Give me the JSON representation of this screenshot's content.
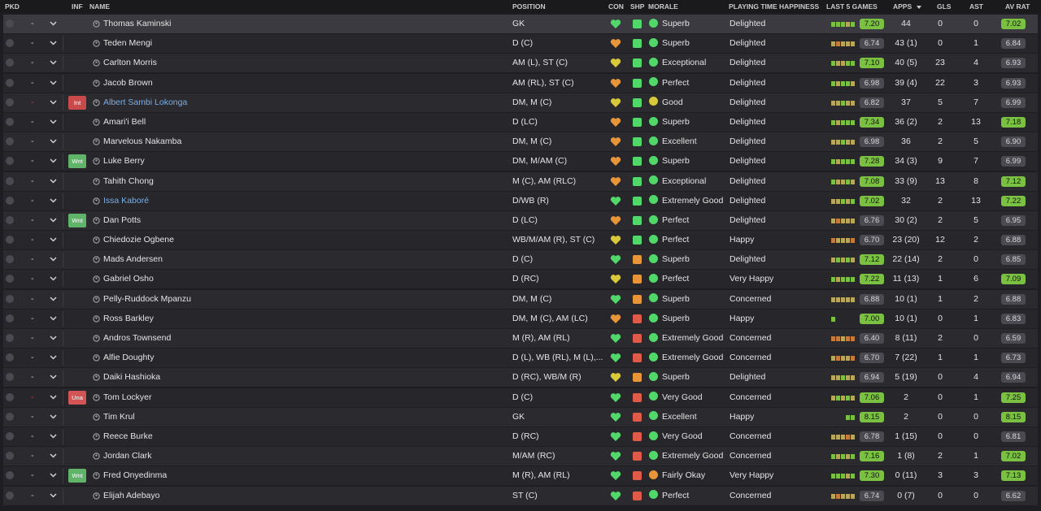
{
  "headers": {
    "pkd": "PKD",
    "inf": "INF",
    "name": "NAME",
    "position": "POSITION",
    "con": "CON",
    "shp": "SHP",
    "morale": "MORALE",
    "pth": "PLAYING TIME HAPPINESS",
    "l5": "LAST 5 GAMES",
    "apps": "APPS",
    "gls": "GLS",
    "ast": "AST",
    "avr": "AV RAT"
  },
  "colors": {
    "rating_high": "#7ac142",
    "rating_mid": "#4a4a50",
    "inf_red": "#c84a4a",
    "inf_green": "#5fb46a",
    "name_link": "#7aaee6"
  },
  "players": [
    {
      "name": "Thomas Kaminski",
      "position": "GK",
      "con": "green",
      "shp": "green",
      "morale_icon": "green",
      "morale": "Superb",
      "pth": "Delighted",
      "l5_rating": "7.20",
      "l5_hi": true,
      "l5_bars": [
        "hi",
        "hi",
        "hi",
        "mid",
        "hi"
      ],
      "apps": "44",
      "gls": "0",
      "ast": "0",
      "avr": "7.02",
      "avr_hi": true,
      "inf": "",
      "dash_red": false,
      "name_link": false,
      "selected": true
    },
    {
      "name": "Teden Mengi",
      "position": "D (C)",
      "con": "orange",
      "shp": "green",
      "morale_icon": "green",
      "morale": "Superb",
      "pth": "Delighted",
      "l5_rating": "6.74",
      "l5_hi": false,
      "l5_bars": [
        "mid",
        "lo",
        "mid",
        "mid",
        "mid"
      ],
      "apps": "43 (1)",
      "gls": "0",
      "ast": "1",
      "avr": "6.84",
      "avr_hi": false,
      "inf": "",
      "dash_red": false,
      "name_link": false
    },
    {
      "name": "Carlton Morris",
      "position": "AM (L), ST (C)",
      "con": "yellow",
      "shp": "green",
      "morale_icon": "green",
      "morale": "Exceptional",
      "pth": "Delighted",
      "l5_rating": "7.10",
      "l5_hi": true,
      "l5_bars": [
        "hi",
        "mid",
        "mid",
        "hi",
        "hi"
      ],
      "apps": "40 (5)",
      "gls": "23",
      "ast": "4",
      "avr": "6.93",
      "avr_hi": false,
      "inf": "",
      "dash_red": false,
      "name_link": false
    },
    {
      "name": "Jacob Brown",
      "position": "AM (RL), ST (C)",
      "con": "orange",
      "shp": "green",
      "morale_icon": "green",
      "morale": "Perfect",
      "pth": "Delighted",
      "l5_rating": "6.98",
      "l5_hi": false,
      "l5_bars": [
        "hi",
        "mid",
        "hi",
        "hi",
        "mid"
      ],
      "apps": "39 (4)",
      "gls": "22",
      "ast": "3",
      "avr": "6.93",
      "avr_hi": false,
      "inf": "",
      "dash_red": false,
      "name_link": false
    },
    {
      "name": "Albert Sambi Lokonga",
      "position": "DM, M (C)",
      "con": "yellow",
      "shp": "green",
      "morale_icon": "yellow",
      "morale": "Good",
      "pth": "Delighted",
      "l5_rating": "6.82",
      "l5_hi": false,
      "l5_bars": [
        "mid",
        "mid",
        "hi",
        "mid",
        "mid"
      ],
      "apps": "37",
      "gls": "5",
      "ast": "7",
      "avr": "6.99",
      "avr_hi": false,
      "inf": "Int",
      "dash_red": true,
      "name_link": true
    },
    {
      "name": "Amari'i Bell",
      "position": "D (LC)",
      "con": "orange",
      "shp": "green",
      "morale_icon": "green",
      "morale": "Superb",
      "pth": "Delighted",
      "l5_rating": "7.34",
      "l5_hi": true,
      "l5_bars": [
        "hi",
        "mid",
        "hi",
        "hi",
        "hi"
      ],
      "apps": "36 (2)",
      "gls": "2",
      "ast": "13",
      "avr": "7.18",
      "avr_hi": true,
      "inf": "",
      "dash_red": false,
      "name_link": false
    },
    {
      "name": "Marvelous Nakamba",
      "position": "DM, M (C)",
      "con": "orange",
      "shp": "green",
      "morale_icon": "green",
      "morale": "Excellent",
      "pth": "Delighted",
      "l5_rating": "6.98",
      "l5_hi": false,
      "l5_bars": [
        "mid",
        "mid",
        "hi",
        "mid",
        "mid"
      ],
      "apps": "36",
      "gls": "2",
      "ast": "5",
      "avr": "6.90",
      "avr_hi": false,
      "inf": "",
      "dash_red": false,
      "name_link": false
    },
    {
      "name": "Luke Berry",
      "position": "DM, M/AM (C)",
      "con": "orange",
      "shp": "green",
      "morale_icon": "green",
      "morale": "Superb",
      "pth": "Delighted",
      "l5_rating": "7.28",
      "l5_hi": true,
      "l5_bars": [
        "hi",
        "mid",
        "hi",
        "hi",
        "hi"
      ],
      "apps": "34 (3)",
      "gls": "9",
      "ast": "7",
      "avr": "6.99",
      "avr_hi": false,
      "inf": "Wnt",
      "dash_red": false,
      "name_link": false
    },
    {
      "name": "Tahith Chong",
      "position": "M (C), AM (RLC)",
      "con": "orange",
      "shp": "green",
      "morale_icon": "green",
      "morale": "Exceptional",
      "pth": "Delighted",
      "l5_rating": "7.08",
      "l5_hi": true,
      "l5_bars": [
        "hi",
        "mid",
        "mid",
        "hi",
        "mid"
      ],
      "apps": "33 (9)",
      "gls": "13",
      "ast": "8",
      "avr": "7.12",
      "avr_hi": true,
      "inf": "",
      "dash_red": false,
      "name_link": false
    },
    {
      "name": "Issa Kaboré",
      "position": "D/WB (R)",
      "con": "green",
      "shp": "green",
      "morale_icon": "green",
      "morale": "Extremely Good",
      "pth": "Delighted",
      "l5_rating": "7.02",
      "l5_hi": true,
      "l5_bars": [
        "mid",
        "mid",
        "hi",
        "mid",
        "hi"
      ],
      "apps": "32",
      "gls": "2",
      "ast": "13",
      "avr": "7.22",
      "avr_hi": true,
      "inf": "",
      "dash_red": false,
      "name_link": true
    },
    {
      "name": "Dan Potts",
      "position": "D (LC)",
      "con": "orange",
      "shp": "green",
      "morale_icon": "green",
      "morale": "Perfect",
      "pth": "Delighted",
      "l5_rating": "6.76",
      "l5_hi": false,
      "l5_bars": [
        "mid",
        "lo",
        "mid",
        "mid",
        "mid"
      ],
      "apps": "30 (2)",
      "gls": "2",
      "ast": "5",
      "avr": "6.95",
      "avr_hi": false,
      "inf": "Wnt",
      "dash_red": false,
      "name_link": false
    },
    {
      "name": "Chiedozie Ogbene",
      "position": "WB/M/AM (R), ST (C)",
      "con": "yellow",
      "shp": "green",
      "morale_icon": "green",
      "morale": "Perfect",
      "pth": "Happy",
      "l5_rating": "6.70",
      "l5_hi": false,
      "l5_bars": [
        "lo",
        "mid",
        "mid",
        "mid",
        "lo"
      ],
      "apps": "23 (20)",
      "gls": "12",
      "ast": "2",
      "avr": "6.88",
      "avr_hi": false,
      "inf": "",
      "dash_red": false,
      "name_link": false
    },
    {
      "name": "Mads Andersen",
      "position": "D (C)",
      "con": "green",
      "shp": "orange",
      "morale_icon": "green",
      "morale": "Superb",
      "pth": "Delighted",
      "l5_rating": "7.12",
      "l5_hi": true,
      "l5_bars": [
        "mid",
        "hi",
        "mid",
        "hi",
        "mid"
      ],
      "apps": "22 (14)",
      "gls": "2",
      "ast": "0",
      "avr": "6.85",
      "avr_hi": false,
      "inf": "",
      "dash_red": false,
      "name_link": false
    },
    {
      "name": "Gabriel Osho",
      "position": "D (RC)",
      "con": "yellow",
      "shp": "orange",
      "morale_icon": "green",
      "morale": "Perfect",
      "pth": "Very Happy",
      "l5_rating": "7.22",
      "l5_hi": true,
      "l5_bars": [
        "hi",
        "mid",
        "hi",
        "hi",
        "hi"
      ],
      "apps": "11 (13)",
      "gls": "1",
      "ast": "6",
      "avr": "7.09",
      "avr_hi": true,
      "inf": "",
      "dash_red": false,
      "name_link": false
    },
    {
      "name": "Pelly-Ruddock Mpanzu",
      "position": "DM, M (C)",
      "con": "green",
      "shp": "orange",
      "morale_icon": "green",
      "morale": "Superb",
      "pth": "Concerned",
      "l5_rating": "6.88",
      "l5_hi": false,
      "l5_bars": [
        "mid",
        "mid",
        "mid",
        "mid",
        "mid"
      ],
      "apps": "10 (1)",
      "gls": "1",
      "ast": "2",
      "avr": "6.88",
      "avr_hi": false,
      "inf": "",
      "dash_red": false,
      "name_link": false
    },
    {
      "name": "Ross Barkley",
      "position": "DM, M (C), AM (LC)",
      "con": "orange",
      "shp": "red",
      "morale_icon": "green",
      "morale": "Superb",
      "pth": "Happy",
      "l5_rating": "7.00",
      "l5_hi": true,
      "l5_bars": [
        "hi",
        "",
        "",
        "",
        ""
      ],
      "apps": "10 (1)",
      "gls": "0",
      "ast": "1",
      "avr": "6.83",
      "avr_hi": false,
      "inf": "",
      "dash_red": false,
      "name_link": false
    },
    {
      "name": "Andros Townsend",
      "position": "M (R), AM (RL)",
      "con": "green",
      "shp": "red",
      "morale_icon": "green",
      "morale": "Extremely Good",
      "pth": "Concerned",
      "l5_rating": "6.40",
      "l5_hi": false,
      "l5_bars": [
        "lo",
        "lo",
        "mid",
        "lo",
        "lo"
      ],
      "apps": "8 (11)",
      "gls": "2",
      "ast": "0",
      "avr": "6.59",
      "avr_hi": false,
      "inf": "",
      "dash_red": false,
      "name_link": false
    },
    {
      "name": "Alfie Doughty",
      "position": "D (L), WB (RL), M (L),...",
      "con": "green",
      "shp": "red",
      "morale_icon": "green",
      "morale": "Extremely Good",
      "pth": "Concerned",
      "l5_rating": "6.70",
      "l5_hi": false,
      "l5_bars": [
        "mid",
        "lo",
        "mid",
        "mid",
        "lo"
      ],
      "apps": "7 (22)",
      "gls": "1",
      "ast": "1",
      "avr": "6.73",
      "avr_hi": false,
      "inf": "",
      "dash_red": false,
      "name_link": false
    },
    {
      "name": "Daiki Hashioka",
      "position": "D (RC), WB/M (R)",
      "con": "yellow",
      "shp": "orange",
      "morale_icon": "green",
      "morale": "Superb",
      "pth": "Delighted",
      "l5_rating": "6.94",
      "l5_hi": false,
      "l5_bars": [
        "mid",
        "mid",
        "hi",
        "mid",
        "mid"
      ],
      "apps": "5 (19)",
      "gls": "0",
      "ast": "4",
      "avr": "6.94",
      "avr_hi": false,
      "inf": "",
      "dash_red": false,
      "name_link": false
    },
    {
      "name": "Tom Lockyer",
      "position": "D (C)",
      "con": "green",
      "shp": "red",
      "morale_icon": "green",
      "morale": "Very Good",
      "pth": "Concerned",
      "l5_rating": "7.06",
      "l5_hi": true,
      "l5_bars": [
        "mid",
        "hi",
        "mid",
        "hi",
        "mid"
      ],
      "apps": "2",
      "gls": "0",
      "ast": "1",
      "avr": "7.25",
      "avr_hi": true,
      "inf": "Una",
      "dash_red": true,
      "name_link": false
    },
    {
      "name": "Tim Krul",
      "position": "GK",
      "con": "green",
      "shp": "red",
      "morale_icon": "green",
      "morale": "Excellent",
      "pth": "Happy",
      "l5_rating": "8.15",
      "l5_hi": true,
      "l5_bars": [
        "",
        "",
        "",
        "hi",
        "hi"
      ],
      "apps": "2",
      "gls": "0",
      "ast": "0",
      "avr": "8.15",
      "avr_hi": true,
      "inf": "",
      "dash_red": false,
      "name_link": false
    },
    {
      "name": "Reece Burke",
      "position": "D (RC)",
      "con": "green",
      "shp": "red",
      "morale_icon": "green",
      "morale": "Very Good",
      "pth": "Concerned",
      "l5_rating": "6.78",
      "l5_hi": false,
      "l5_bars": [
        "mid",
        "mid",
        "mid",
        "lo",
        "mid"
      ],
      "apps": "1 (15)",
      "gls": "0",
      "ast": "0",
      "avr": "6.81",
      "avr_hi": false,
      "inf": "",
      "dash_red": false,
      "name_link": false
    },
    {
      "name": "Jordan Clark",
      "position": "M/AM (RC)",
      "con": "green",
      "shp": "red",
      "morale_icon": "green",
      "morale": "Extremely Good",
      "pth": "Concerned",
      "l5_rating": "7.16",
      "l5_hi": true,
      "l5_bars": [
        "hi",
        "mid",
        "hi",
        "mid",
        "hi"
      ],
      "apps": "1 (8)",
      "gls": "2",
      "ast": "1",
      "avr": "7.02",
      "avr_hi": true,
      "inf": "",
      "dash_red": false,
      "name_link": false
    },
    {
      "name": "Fred Onyedinma",
      "position": "M (R), AM (RL)",
      "con": "green",
      "shp": "red",
      "morale_icon": "orange",
      "morale": "Fairly Okay",
      "pth": "Very Happy",
      "l5_rating": "7.30",
      "l5_hi": true,
      "l5_bars": [
        "hi",
        "hi",
        "hi",
        "mid",
        "hi"
      ],
      "apps": "0 (11)",
      "gls": "3",
      "ast": "3",
      "avr": "7.13",
      "avr_hi": true,
      "inf": "Wnt",
      "dash_red": false,
      "name_link": false
    },
    {
      "name": "Elijah Adebayo",
      "position": "ST (C)",
      "con": "green",
      "shp": "red",
      "morale_icon": "green",
      "morale": "Perfect",
      "pth": "Concerned",
      "l5_rating": "6.74",
      "l5_hi": false,
      "l5_bars": [
        "mid",
        "lo",
        "mid",
        "mid",
        "mid"
      ],
      "apps": "0 (7)",
      "gls": "0",
      "ast": "0",
      "avr": "6.62",
      "avr_hi": false,
      "inf": "",
      "dash_red": false,
      "name_link": false
    }
  ]
}
